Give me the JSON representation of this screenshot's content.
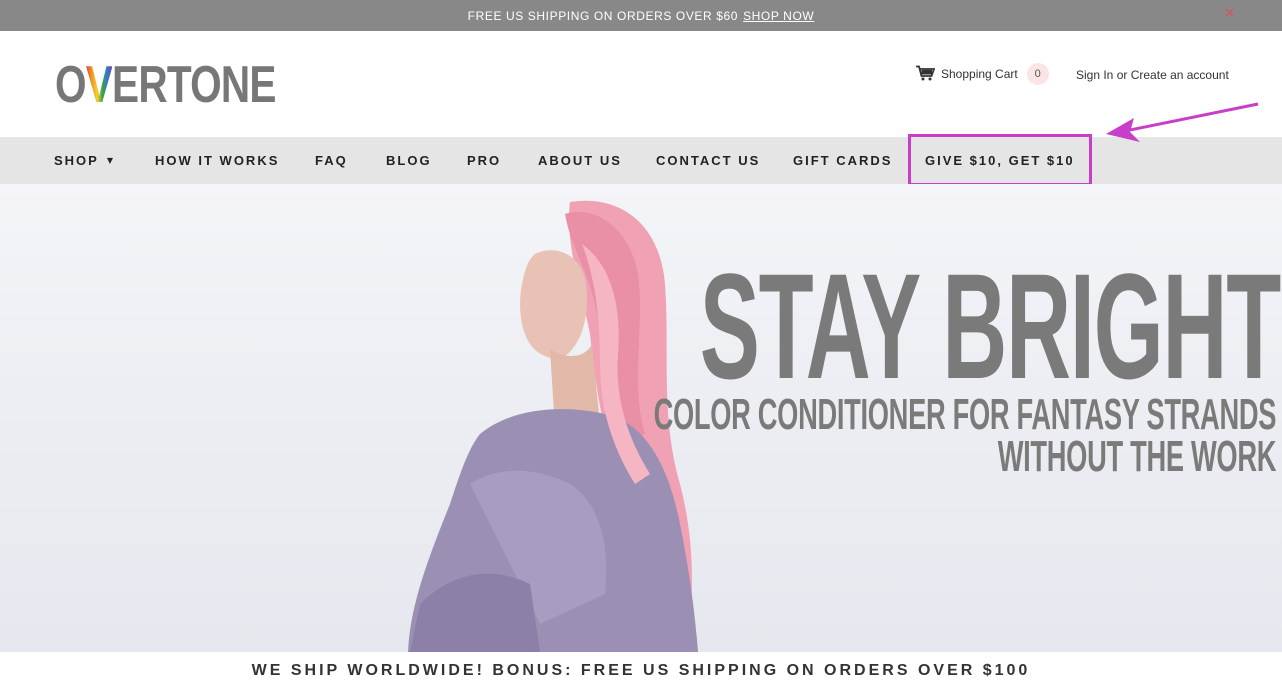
{
  "promo": {
    "text": "FREE US SHIPPING ON ORDERS OVER $60",
    "link": "SHOP NOW",
    "close": "×"
  },
  "header": {
    "logo_prefix": "O",
    "logo_v": "V",
    "logo_suffix": "ERTONE",
    "cart_label": "Shopping Cart",
    "cart_count": "0",
    "sign_in": "Sign In",
    "or_text": "or",
    "create_account": "Create an account"
  },
  "nav": {
    "shop": "SHOP",
    "how_it_works": "HOW IT WORKS",
    "faq": "FAQ",
    "blog": "BLOG",
    "pro": "PRO",
    "about_us": "ABOUT US",
    "contact_us": "CONTACT US",
    "gift_cards": "GIFT CARDS",
    "give_get": "GIVE $10, GET $10"
  },
  "hero": {
    "headline": "STAY BRIGHT",
    "sub_line1": "COLOR CONDITIONER FOR FANTASY STRANDS",
    "sub_line2": "WITHOUT THE WORK"
  },
  "shipping_banner": "WE SHIP WORLDWIDE! BONUS: FREE US SHIPPING ON ORDERS OVER $100",
  "colors": {
    "promo_bar": "#888888",
    "nav_bg": "#e5e5e5",
    "highlight": "#c93ec9",
    "headline": "#7a7a7a"
  },
  "icons": [
    "cart-icon",
    "caret-down-icon",
    "close-icon",
    "annotation-arrow"
  ]
}
